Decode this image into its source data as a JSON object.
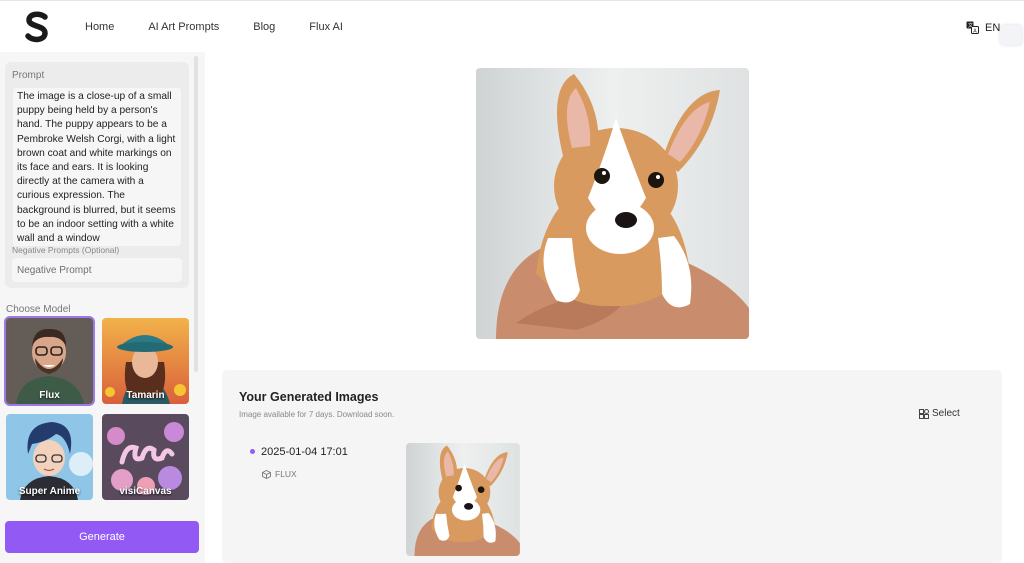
{
  "header": {
    "logo_icon": "s-logo-icon",
    "nav": [
      {
        "label": "Home"
      },
      {
        "label": "AI Art Prompts"
      },
      {
        "label": "Blog"
      },
      {
        "label": "Flux AI"
      }
    ],
    "language": "EN",
    "language_icon": "translate-icon"
  },
  "sidebar": {
    "prompt_label": "Prompt",
    "prompt_value": "The image is a close-up of a small puppy being held by a person's hand. The puppy appears to be a Pembroke Welsh Corgi, with a light brown coat and white markings on its face and ears. It is looking directly at the camera with a curious expression. The background is blurred, but it seems to be an indoor setting with a white wall and a window",
    "negative_label": "Negative Prompts  (Optional)",
    "negative_placeholder": "Negative Prompt",
    "choose_model_label": "Choose Model",
    "models": [
      {
        "name": "Flux",
        "selected": true
      },
      {
        "name": "Tamarin",
        "selected": false
      },
      {
        "name": "Super Anime",
        "selected": false
      },
      {
        "name": "visiCanvas",
        "selected": false
      }
    ],
    "generate_label": "Generate"
  },
  "results": {
    "title": "Your Generated Images",
    "subtitle": "Image available for 7 days. Download soon.",
    "select_label": "Select",
    "entries": [
      {
        "timestamp": "2025-01-04 17:01",
        "model": "FLUX"
      }
    ]
  },
  "colors": {
    "accent": "#9259f4",
    "dot": "#8f5ef2"
  }
}
